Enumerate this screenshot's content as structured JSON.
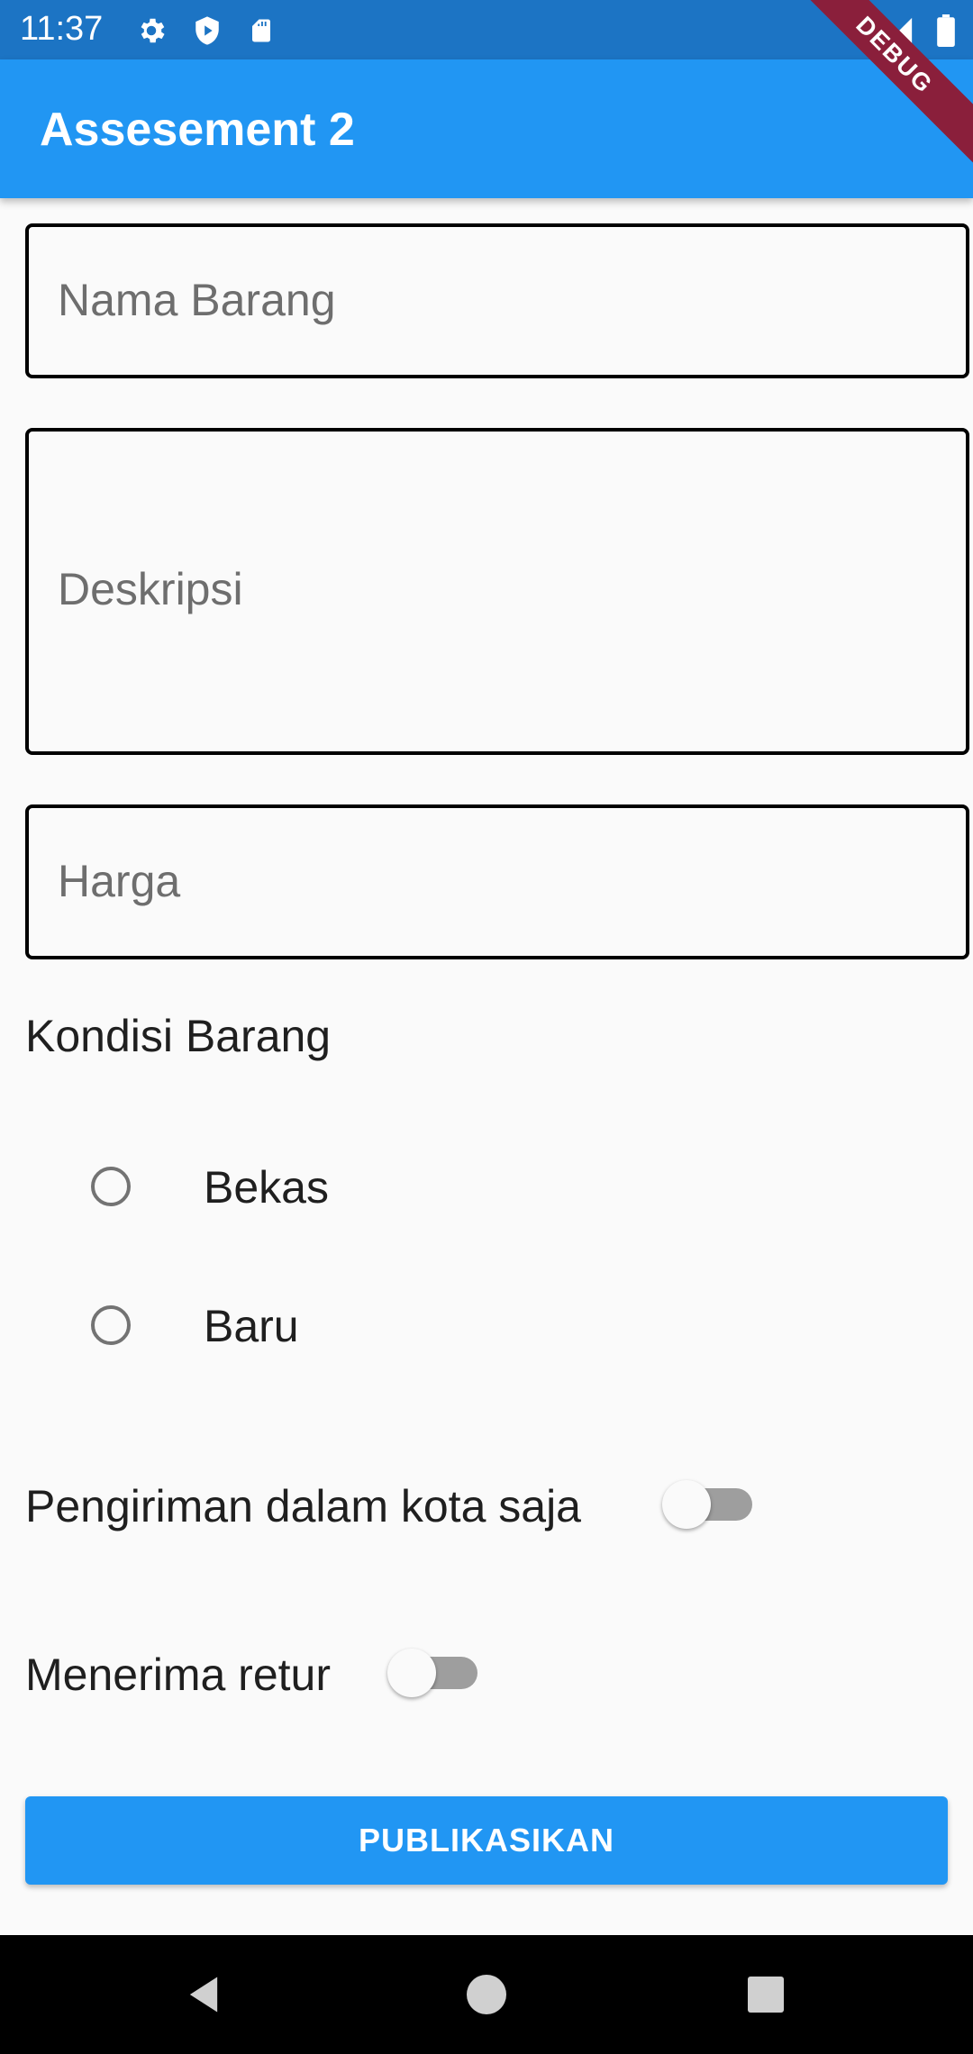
{
  "status_bar": {
    "time": "11:37",
    "left_icons": [
      "gear-icon",
      "shield-icon",
      "sd-card-icon"
    ],
    "right_icons": [
      "wifi-icon",
      "signal-icon",
      "battery-icon"
    ]
  },
  "debug_banner": "DEBUG",
  "app_bar": {
    "title": "Assesement 2"
  },
  "form": {
    "nama_barang_placeholder": "Nama Barang",
    "deskripsi_placeholder": "Deskripsi",
    "harga_placeholder": "Harga",
    "kondisi_label": "Kondisi Barang",
    "kondisi_options": [
      {
        "label": "Bekas",
        "selected": false
      },
      {
        "label": "Baru",
        "selected": false
      }
    ],
    "switches": [
      {
        "label": "Pengiriman dalam kota saja",
        "on": false
      },
      {
        "label": "Menerima retur",
        "on": false
      }
    ],
    "publish_label": "PUBLIKASIKAN"
  },
  "nav_bar": {
    "icons": [
      "back-icon",
      "home-icon",
      "recents-icon"
    ]
  },
  "colors": {
    "primary": "#2196f3",
    "status_bar": "#1c74c4",
    "debug": "#8a1f3b"
  }
}
